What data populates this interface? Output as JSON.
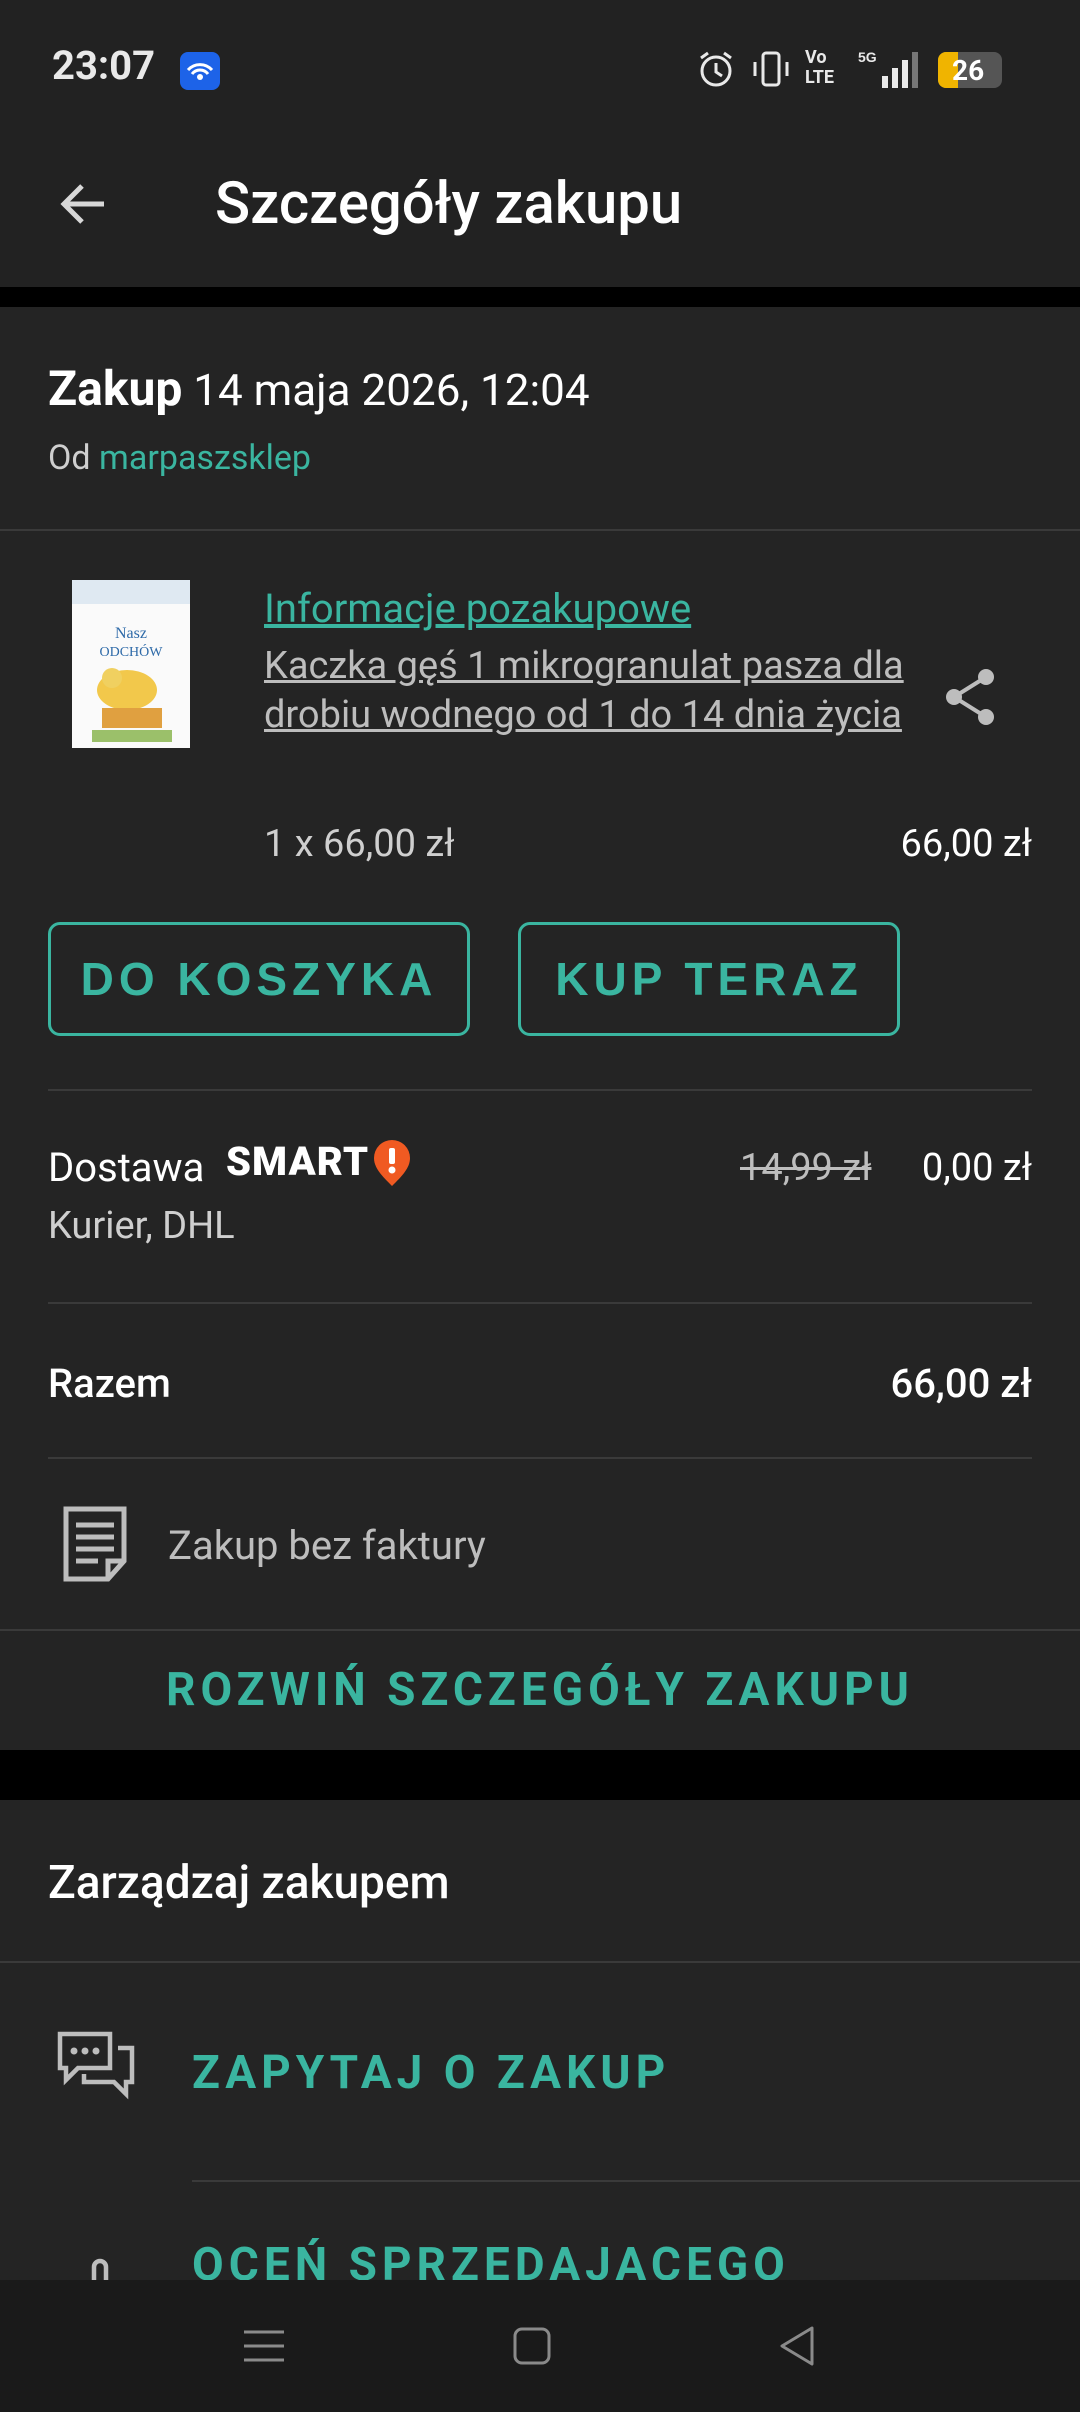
{
  "status_bar": {
    "time": "23:07",
    "battery": "26"
  },
  "app_bar": {
    "title": "Szczegóły zakupu"
  },
  "purchase": {
    "label": "Zakup",
    "date": "14 maja 2026, 12:04",
    "from_label": "Od",
    "seller": "marpaszsklep"
  },
  "item": {
    "info_link": "Informacje pozakupowe",
    "name": "Kaczka gęś 1 mikrogranulat pasza dla drobiu wodnego od 1 do 14 dnia życia",
    "quantity_price": "1 x 66,00 zł",
    "total": "66,00 zł"
  },
  "buttons": {
    "to_cart": "DO KOSZYKA",
    "buy_now": "KUP TERAZ",
    "expand": "ROZWIŃ SZCZEGÓŁY ZAKUPU"
  },
  "delivery": {
    "label": "Dostawa",
    "smart": "SMART",
    "old_price": "14,99 zł",
    "price": "0,00 zł",
    "method": "Kurier, DHL"
  },
  "summary": {
    "label": "Razem",
    "value": "66,00 zł"
  },
  "invoice": {
    "text": "Zakup bez faktury"
  },
  "manage": {
    "title": "Zarządzaj zakupem",
    "ask": "ZAPYTAJ O ZAKUP",
    "rate": "OCEŃ SPRZEDAJĄCEGO"
  },
  "colors": {
    "accent": "#3ab5a0",
    "background": "#242424",
    "smart_badge": "#f05a22"
  },
  "icons": [
    "back-arrow-icon",
    "share-icon",
    "document-icon",
    "chat-icon",
    "menu-icon",
    "home-icon",
    "back-triangle-icon"
  ]
}
